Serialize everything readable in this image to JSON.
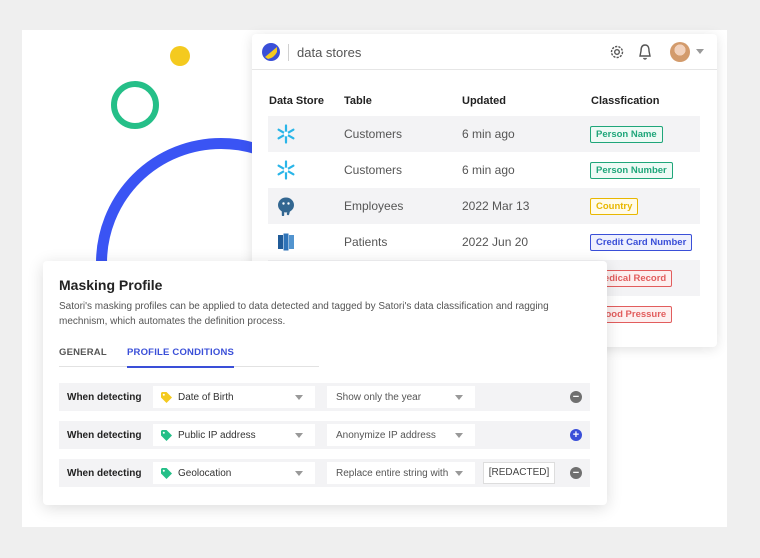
{
  "header": {
    "title": "data stores"
  },
  "table": {
    "columns": [
      "Data Store",
      "Table",
      "Updated",
      "Classfication"
    ],
    "rows": [
      {
        "store_icon": "snowflake-icon",
        "table": "Customers",
        "updated": "6 min ago",
        "classification": "Person Name",
        "color": "#1fa67a"
      },
      {
        "store_icon": "snowflake-icon",
        "table": "Customers",
        "updated": "6 min ago",
        "classification": "Person Number",
        "color": "#1fa67a"
      },
      {
        "store_icon": "postgres-icon",
        "table": "Employees",
        "updated": "2022 Mar 13",
        "classification": "Country",
        "color": "#e8b700"
      },
      {
        "store_icon": "redshift-icon",
        "table": "Patients",
        "updated": "2022 Jun 20",
        "classification": "Credit Card Number",
        "color": "#3a4fd8"
      },
      {
        "classification": "Medical Record",
        "color": "#e25d5d"
      },
      {
        "classification": "Blood Pressure",
        "color": "#e25d5d"
      }
    ]
  },
  "masking": {
    "title": "Masking Profile",
    "description": "Satori's masking profiles can be applied to data detected and tagged by Satori's data classification and ragging mechnism, which automates the definition process.",
    "tabs": [
      "GENERAL",
      "PROFILE CONDITIONS"
    ],
    "active_tab": "PROFILE CONDITIONS",
    "conditions": [
      {
        "label": "When detecting",
        "tag": "Date of Birth",
        "tag_color": "#f4ca1f",
        "action": "Show only the year",
        "button": "remove"
      },
      {
        "label": "When detecting",
        "tag": "Public IP address",
        "tag_color": "#25bf88",
        "action": "Anonymize IP address",
        "button": "add"
      },
      {
        "label": "When detecting",
        "tag": "Geolocation",
        "tag_color": "#25bf88",
        "action": "Replace entire string with",
        "replacement": "[REDACTED]",
        "button": "remove"
      }
    ]
  },
  "colors": {
    "accent": "#3a4fd8",
    "green": "#25bf88",
    "yellow": "#f4ca1f",
    "blue_ring": "#3a54f4"
  }
}
